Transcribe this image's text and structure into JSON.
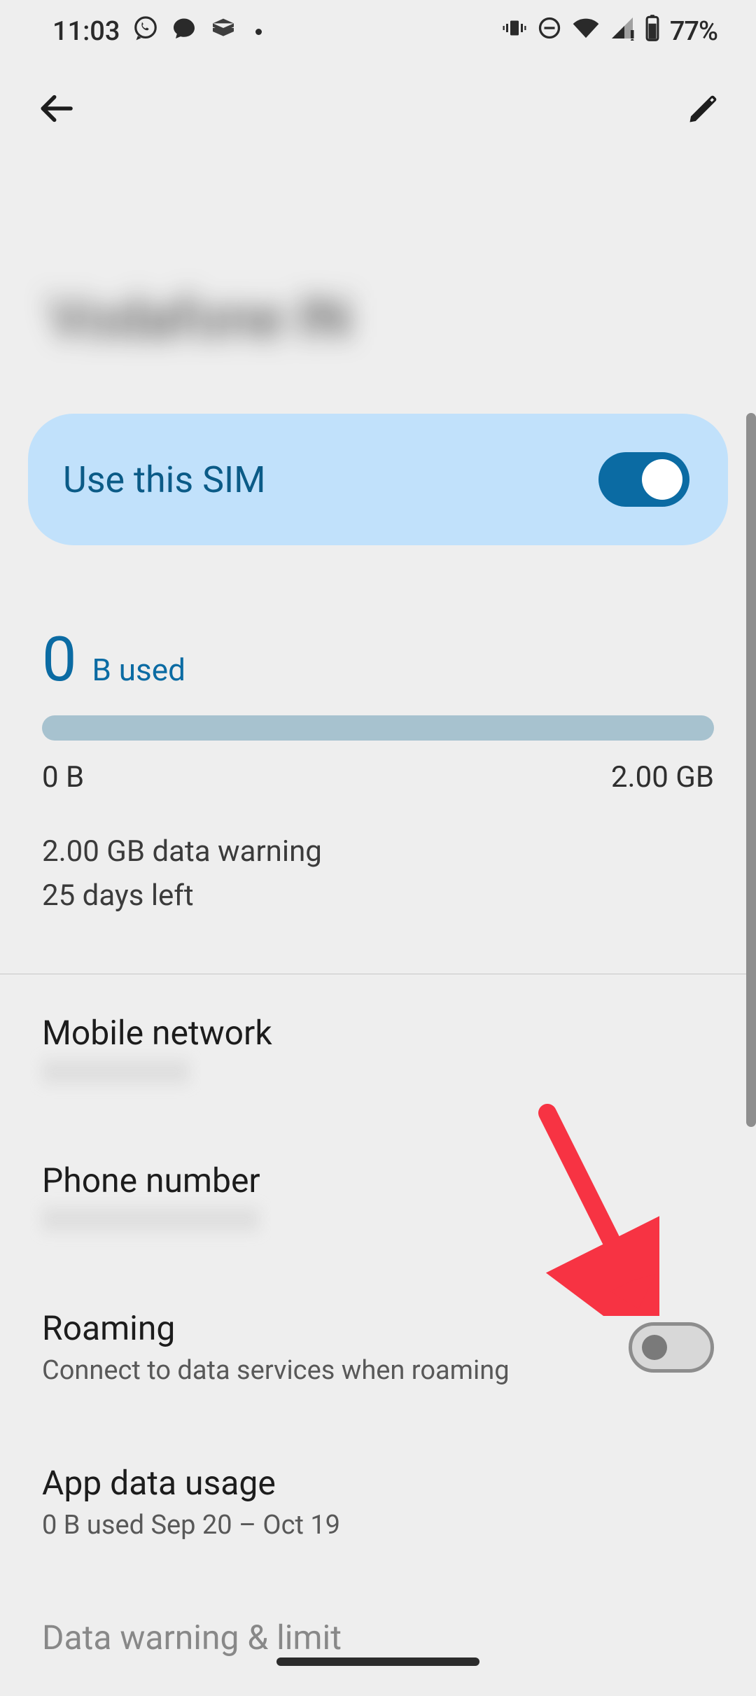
{
  "status": {
    "time": "11:03",
    "battery_text": "77%"
  },
  "page": {
    "carrier_title": "Vodafone IN"
  },
  "sim": {
    "use_label": "Use this SIM",
    "enabled": true
  },
  "usage": {
    "value": "0",
    "unit": "B used",
    "min_label": "0 B",
    "max_label": "2.00 GB",
    "warning_line1": "2.00 GB data warning",
    "warning_line2": "25 days left"
  },
  "settings": {
    "mobile_network": {
      "title": "Mobile network",
      "subtitle": ""
    },
    "phone_number": {
      "title": "Phone number",
      "subtitle": ""
    },
    "roaming": {
      "title": "Roaming",
      "subtitle": "Connect to data services when roaming",
      "enabled": false
    },
    "app_data_usage": {
      "title": "App data usage",
      "subtitle": "0 B used Sep 20 – Oct 19"
    },
    "data_warning_limit": {
      "title": "Data warning & limit"
    }
  }
}
